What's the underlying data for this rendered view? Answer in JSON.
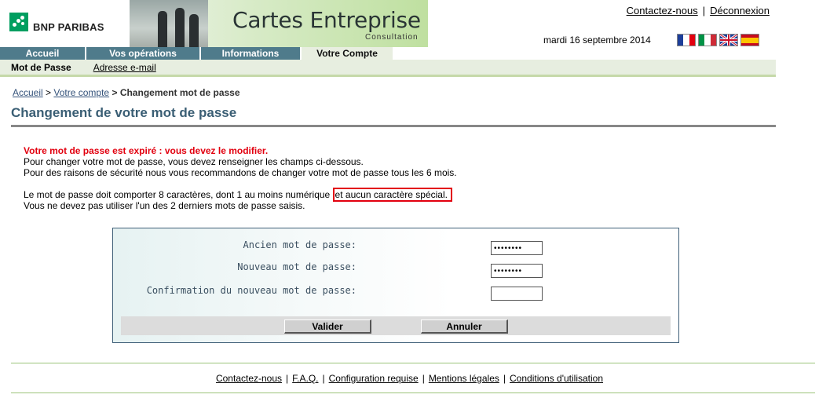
{
  "brand": {
    "logo_text": "BNP PARIBAS",
    "accent": "#009e60"
  },
  "banner": {
    "title": "Cartes Entreprise",
    "subtitle": "Consultation"
  },
  "top_links": {
    "contact": "Contactez-nous",
    "separator": "|",
    "logout": "Déconnexion"
  },
  "date": "mardi 16 septembre 2014",
  "languages": [
    "fr-flag",
    "it-flag",
    "uk-flag",
    "es-flag"
  ],
  "nav": {
    "items": [
      {
        "label": "Accueil"
      },
      {
        "label": "Vos opérations"
      },
      {
        "label": "Informations"
      },
      {
        "label": "Votre Compte",
        "active": true
      }
    ]
  },
  "subnav": {
    "current": "Mot de Passe",
    "link": "Adresse e-mail"
  },
  "breadcrumb": {
    "home": "Accueil",
    "sep1": ">",
    "account": "Votre compte",
    "sep2": ">",
    "current": "Changement mot de passe"
  },
  "page_title": "Changement de votre mot de passe",
  "info": {
    "warning": "Votre mot de passe est expiré : vous devez le modifier.",
    "line1": "Pour changer votre mot de passe, vous devez renseigner les champs ci-dessous.",
    "line2": "Pour des raisons de sécurité nous vous recommandons de changer votre mot de passe tous les 6 mois.",
    "rule_start": "Le mot de passe doit comporter 8 caractères, dont 1 au moins numérique ",
    "rule_highlight": "et aucun caractère spécial.",
    "line4": "Vous ne devez pas utiliser l'un des 2 derniers mots de passe saisis."
  },
  "form": {
    "old_label": "Ancien mot de passe:",
    "old_value": "••••••••",
    "new_label": "Nouveau mot de passe:",
    "new_value": "••••••••",
    "confirm_label": "Confirmation du nouveau mot de passe:",
    "confirm_value": "",
    "submit": "Valider",
    "cancel": "Annuler"
  },
  "footer": {
    "links": [
      "Contactez-nous",
      "F.A.Q.",
      "Configuration requise",
      "Mentions légales",
      "Conditions d'utilisation"
    ],
    "separator": "|"
  }
}
